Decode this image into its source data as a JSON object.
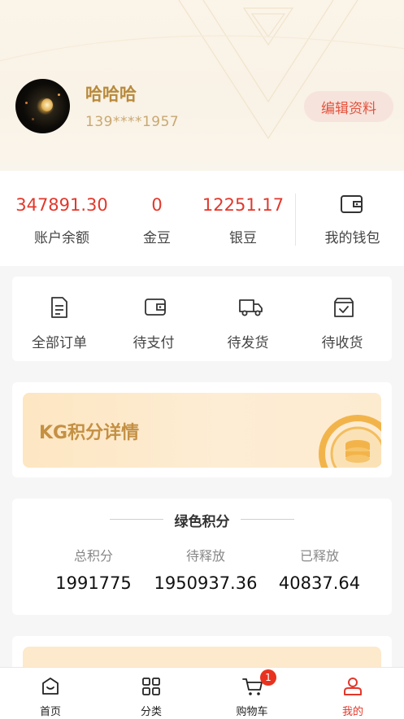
{
  "profile": {
    "username": "哈哈哈",
    "phone": "139****1957",
    "edit_label": "编辑资料"
  },
  "balance": {
    "items": [
      {
        "value": "347891.30",
        "label": "账户余额"
      },
      {
        "value": "0",
        "label": "金豆"
      },
      {
        "value": "12251.17",
        "label": "银豆"
      }
    ],
    "wallet_label": "我的钱包"
  },
  "orders": {
    "items": [
      {
        "label": "全部订单",
        "icon": "order-list-icon"
      },
      {
        "label": "待支付",
        "icon": "wallet-icon"
      },
      {
        "label": "待发货",
        "icon": "truck-icon"
      },
      {
        "label": "待收货",
        "icon": "box-check-icon"
      }
    ]
  },
  "kg": {
    "title": "KG积分详情"
  },
  "green_points": {
    "title": "绿色积分",
    "columns": [
      {
        "label": "总积分",
        "value": "1991775"
      },
      {
        "label": "待释放",
        "value": "1950937.36"
      },
      {
        "label": "已释放",
        "value": "40837.64"
      }
    ]
  },
  "tabbar": {
    "items": [
      {
        "label": "首页",
        "icon": "home-icon"
      },
      {
        "label": "分类",
        "icon": "grid-icon"
      },
      {
        "label": "购物车",
        "icon": "cart-icon",
        "badge": "1"
      },
      {
        "label": "我的",
        "icon": "user-icon",
        "active": true
      }
    ]
  },
  "colors": {
    "accent_red": "#e2382b",
    "gold": "#b88a3c",
    "header_bg": "#fbf4e9"
  }
}
